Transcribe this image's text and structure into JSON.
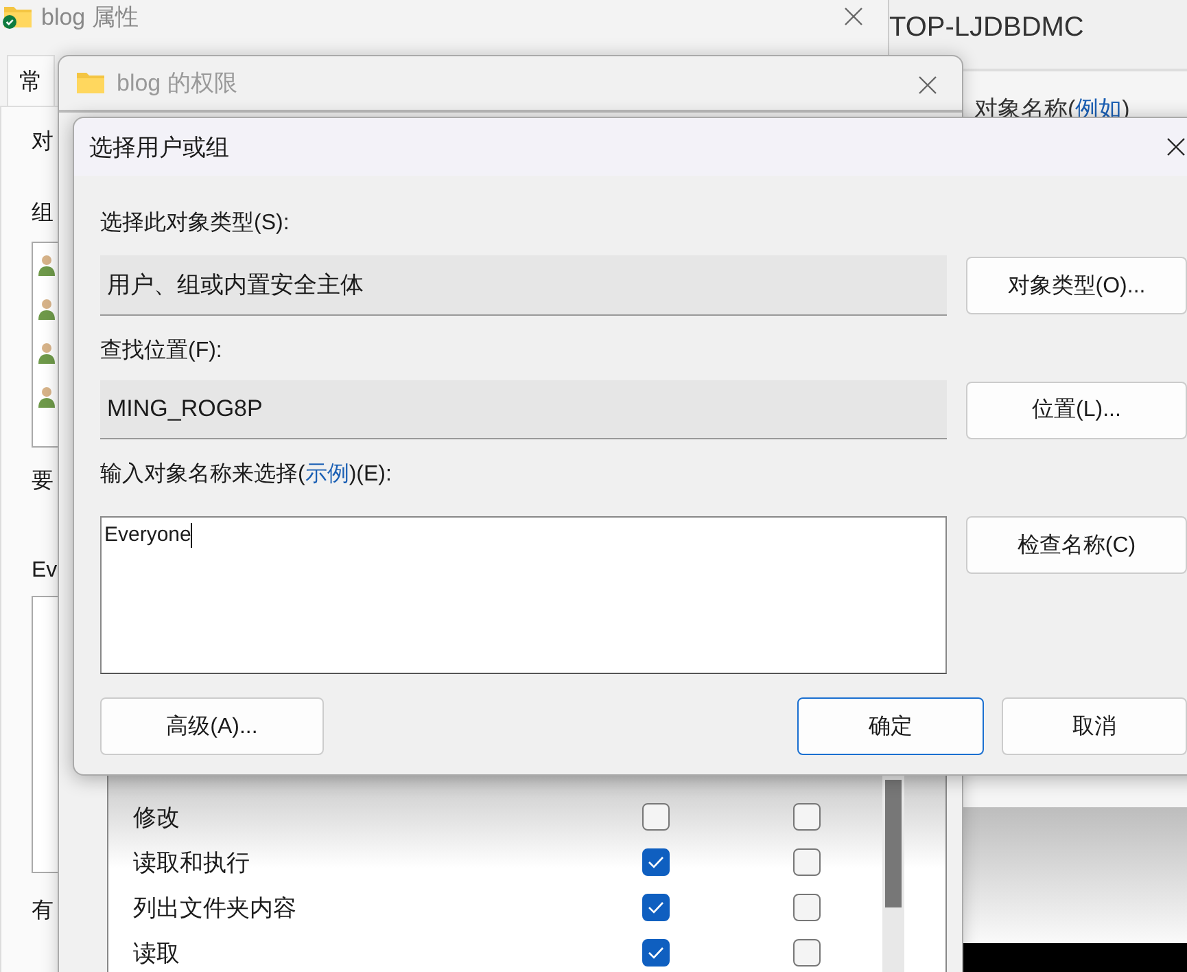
{
  "background_window": {
    "title": "TOP-LJDBDMC",
    "prompt_before": "对象名称(",
    "prompt_link": "例如",
    "prompt_after": ")"
  },
  "properties_window": {
    "title": "blog 属性",
    "tabs": [
      {
        "label": "常",
        "selected": true
      }
    ],
    "labels": [
      "对",
      "组",
      "要",
      "Ev",
      "有"
    ],
    "members": [
      {
        "kind": "user"
      },
      {
        "kind": "user"
      },
      {
        "kind": "user"
      },
      {
        "kind": "user"
      }
    ]
  },
  "permissions_window": {
    "title": "blog 的权限",
    "permissions": [
      {
        "name": "修改",
        "allow": false,
        "deny": false
      },
      {
        "name": "读取和执行",
        "allow": true,
        "deny": false
      },
      {
        "name": "列出文件夹内容",
        "allow": true,
        "deny": false
      },
      {
        "name": "读取",
        "allow": true,
        "deny": false
      }
    ]
  },
  "dialog": {
    "title": "选择用户或组",
    "object_type": {
      "label": "选择此对象类型(S):",
      "value": "用户、组或内置安全主体",
      "button": "对象类型(O)..."
    },
    "location": {
      "label": "查找位置(F):",
      "value": "MING_ROG8P",
      "button": "位置(L)..."
    },
    "names": {
      "label_before": "输入对象名称来选择(",
      "link": "示例",
      "label_after": ")(E):",
      "value": "Everyone",
      "button": "检查名称(C)"
    },
    "buttons": [
      {
        "label": "高级(A)...",
        "kind": "secondary"
      },
      {
        "label": "确定",
        "kind": "default"
      },
      {
        "label": "取消",
        "kind": "secondary"
      }
    ]
  }
}
